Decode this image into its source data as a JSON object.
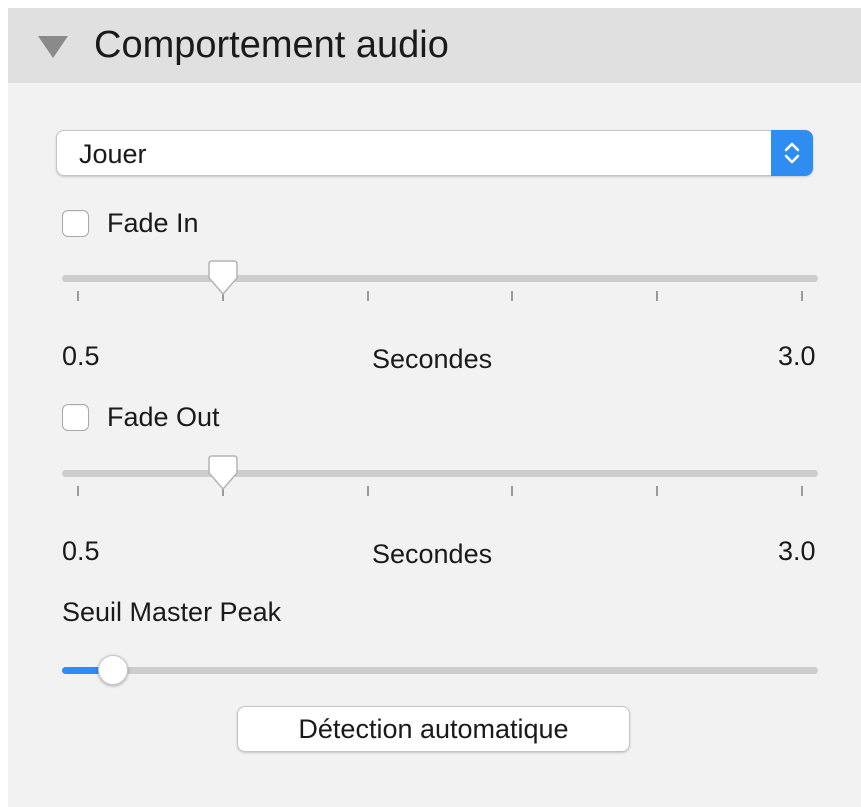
{
  "panel": {
    "title": "Comportement audio",
    "disclosure_icon": "disclosure-triangle-down-icon"
  },
  "action_popup": {
    "selected": "Jouer",
    "stepper_icon": "up-down-chevrons-icon",
    "accent": "#2f8cf0"
  },
  "fade_in": {
    "label": "Fade In",
    "checked": false,
    "slider_min": 0.5,
    "slider_max": 3.0,
    "slider_value": 1.0,
    "tick_count": 6,
    "min_label": "0.5",
    "unit_label": "Secondes",
    "max_label": "3.0"
  },
  "fade_out": {
    "label": "Fade Out",
    "checked": false,
    "slider_min": 0.5,
    "slider_max": 3.0,
    "slider_value": 1.0,
    "tick_count": 6,
    "min_label": "0.5",
    "unit_label": "Secondes",
    "max_label": "3.0"
  },
  "master_peak": {
    "label": "Seuil Master Peak",
    "level_fraction": 0.05
  },
  "auto_detect_button": {
    "label": "Détection automatique"
  }
}
